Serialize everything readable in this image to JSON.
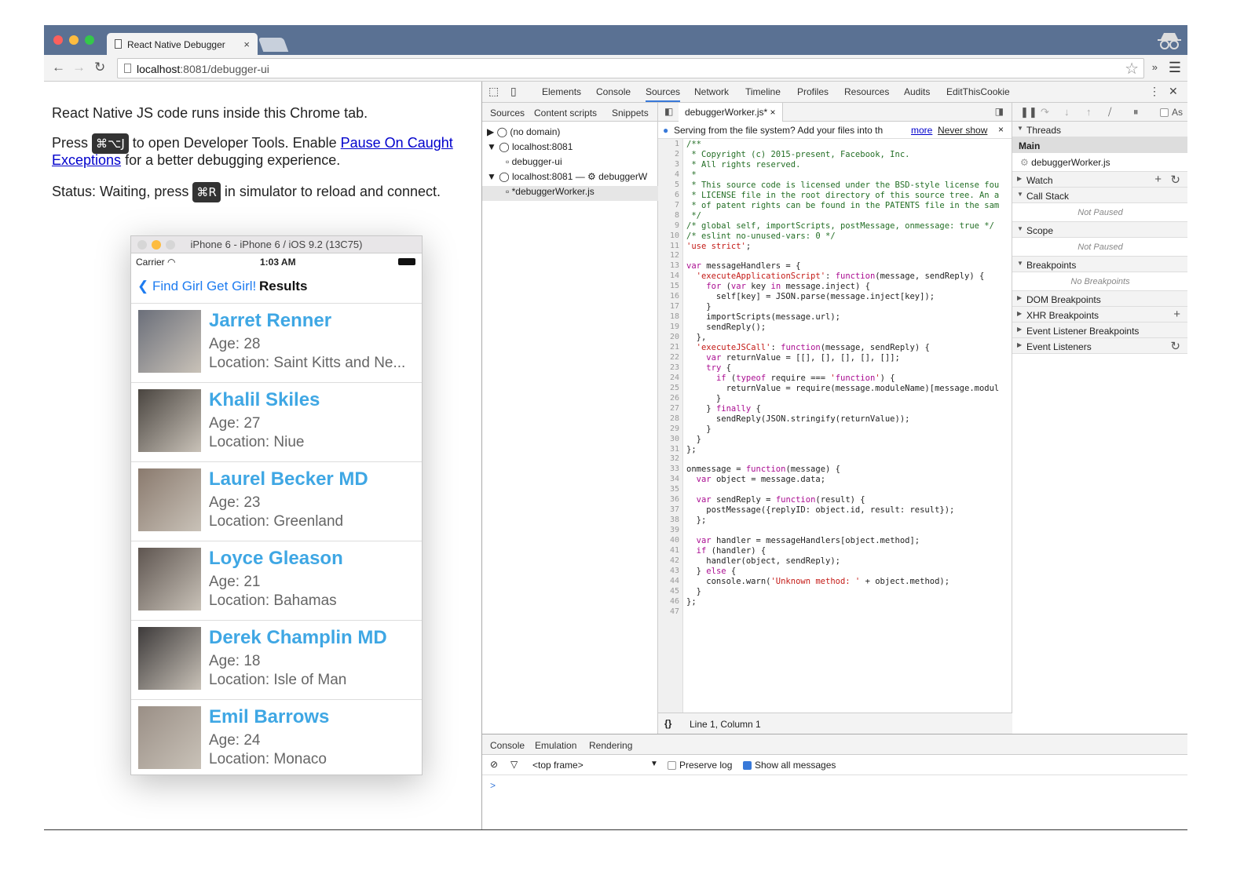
{
  "browser": {
    "tab_title": "React Native Debugger",
    "url_host": "localhost",
    "url_path": ":8081/debugger-ui"
  },
  "page": {
    "line1": "React Native JS code runs inside this Chrome tab.",
    "line2_pre": "Press",
    "line2_kbd": "⌘⌥J",
    "line2_mid": "to open Developer Tools. Enable",
    "line2_link1": "Pause On Caught",
    "line2_link2": "Exceptions",
    "line2_post": "for a better debugging experience.",
    "line3_pre": "Status: Waiting, press",
    "line3_kbd": "⌘R",
    "line3_post": "in simulator to reload and connect."
  },
  "simulator": {
    "title": "iPhone 6 - iPhone 6 / iOS 9.2 (13C75)",
    "carrier": "Carrier",
    "time": "1:03 AM",
    "back_label": "Find Girl Get Girl!",
    "nav_title": "Results",
    "rows": [
      {
        "name": "Jarret Renner",
        "age": "Age: 28",
        "location": "Location: Saint Kitts and Ne..."
      },
      {
        "name": "Khalil Skiles",
        "age": "Age: 27",
        "location": "Location: Niue"
      },
      {
        "name": "Laurel Becker MD",
        "age": "Age: 23",
        "location": "Location: Greenland"
      },
      {
        "name": "Loyce Gleason",
        "age": "Age: 21",
        "location": "Location: Bahamas"
      },
      {
        "name": "Derek Champlin MD",
        "age": "Age: 18",
        "location": "Location: Isle of Man"
      },
      {
        "name": "Emil Barrows",
        "age": "Age: 24",
        "location": "Location: Monaco"
      }
    ]
  },
  "devtools": {
    "tabs": [
      "Elements",
      "Console",
      "Sources",
      "Network",
      "Timeline",
      "Profiles",
      "Resources",
      "Audits",
      "EditThisCookie"
    ],
    "active_tab": "Sources",
    "navigator_tabs": [
      "Sources",
      "Content scripts",
      "Snippets"
    ],
    "tree": [
      "(no domain)",
      "localhost:8081",
      "debugger-ui",
      "localhost:8081 — ⚙ debuggerW",
      "*debuggerWorker.js"
    ],
    "editor_tab": "debuggerWorker.js*",
    "info_text": "Serving from the file system? Add your files into th",
    "info_more": "more",
    "info_never": "Never show",
    "status_text": "Line 1, Column 1",
    "code": [
      "/**",
      " * Copyright (c) 2015-present, Facebook, Inc.",
      " * All rights reserved.",
      " *",
      " * This source code is licensed under the BSD-style license fou",
      " * LICENSE file in the root directory of this source tree. An a",
      " * of patent rights can be found in the PATENTS file in the sam",
      " */",
      "/* global self, importScripts, postMessage, onmessage: true */",
      "/* eslint no-unused-vars: 0 */",
      "'use strict';",
      "",
      "var messageHandlers = {",
      "  'executeApplicationScript': function(message, sendReply) {",
      "    for (var key in message.inject) {",
      "      self[key] = JSON.parse(message.inject[key]);",
      "    }",
      "    importScripts(message.url);",
      "    sendReply();",
      "  },",
      "  'executeJSCall': function(message, sendReply) {",
      "    var returnValue = [[], [], [], [], []];",
      "    try {",
      "      if (typeof require === 'function') {",
      "        returnValue = require(message.moduleName)[message.modul",
      "      }",
      "    } finally {",
      "      sendReply(JSON.stringify(returnValue));",
      "    }",
      "  }",
      "};",
      "",
      "onmessage = function(message) {",
      "  var object = message.data;",
      "",
      "  var sendReply = function(result) {",
      "    postMessage({replyID: object.id, result: result});",
      "  };",
      "",
      "  var handler = messageHandlers[object.method];",
      "  if (handler) {",
      "    handler(object, sendReply);",
      "  } else {",
      "    console.warn('Unknown method: ' + object.method);",
      "  }",
      "};",
      ""
    ],
    "right": {
      "as_label": "As",
      "threads": "Threads",
      "main": "Main",
      "worker": "debuggerWorker.js",
      "watch": "Watch",
      "call_stack": "Call Stack",
      "not_paused": "Not Paused",
      "scope": "Scope",
      "scope_empty": "Not Paused",
      "breakpoints": "Breakpoints",
      "no_breakpoints": "No Breakpoints",
      "dom_breakpoints": "DOM Breakpoints",
      "xhr_breakpoints": "XHR Breakpoints",
      "event_listener_breakpoints": "Event Listener Breakpoints",
      "event_listeners": "Event Listeners"
    },
    "console": {
      "tabs": [
        "Console",
        "Emulation",
        "Rendering"
      ],
      "frame": "<top frame>",
      "preserve_log": "Preserve log",
      "show_all": "Show all messages",
      "prompt": ">"
    }
  },
  "colors": {
    "accent": "#3fa7e4",
    "tabbar": "#5a7193",
    "link": "#0000cc"
  }
}
